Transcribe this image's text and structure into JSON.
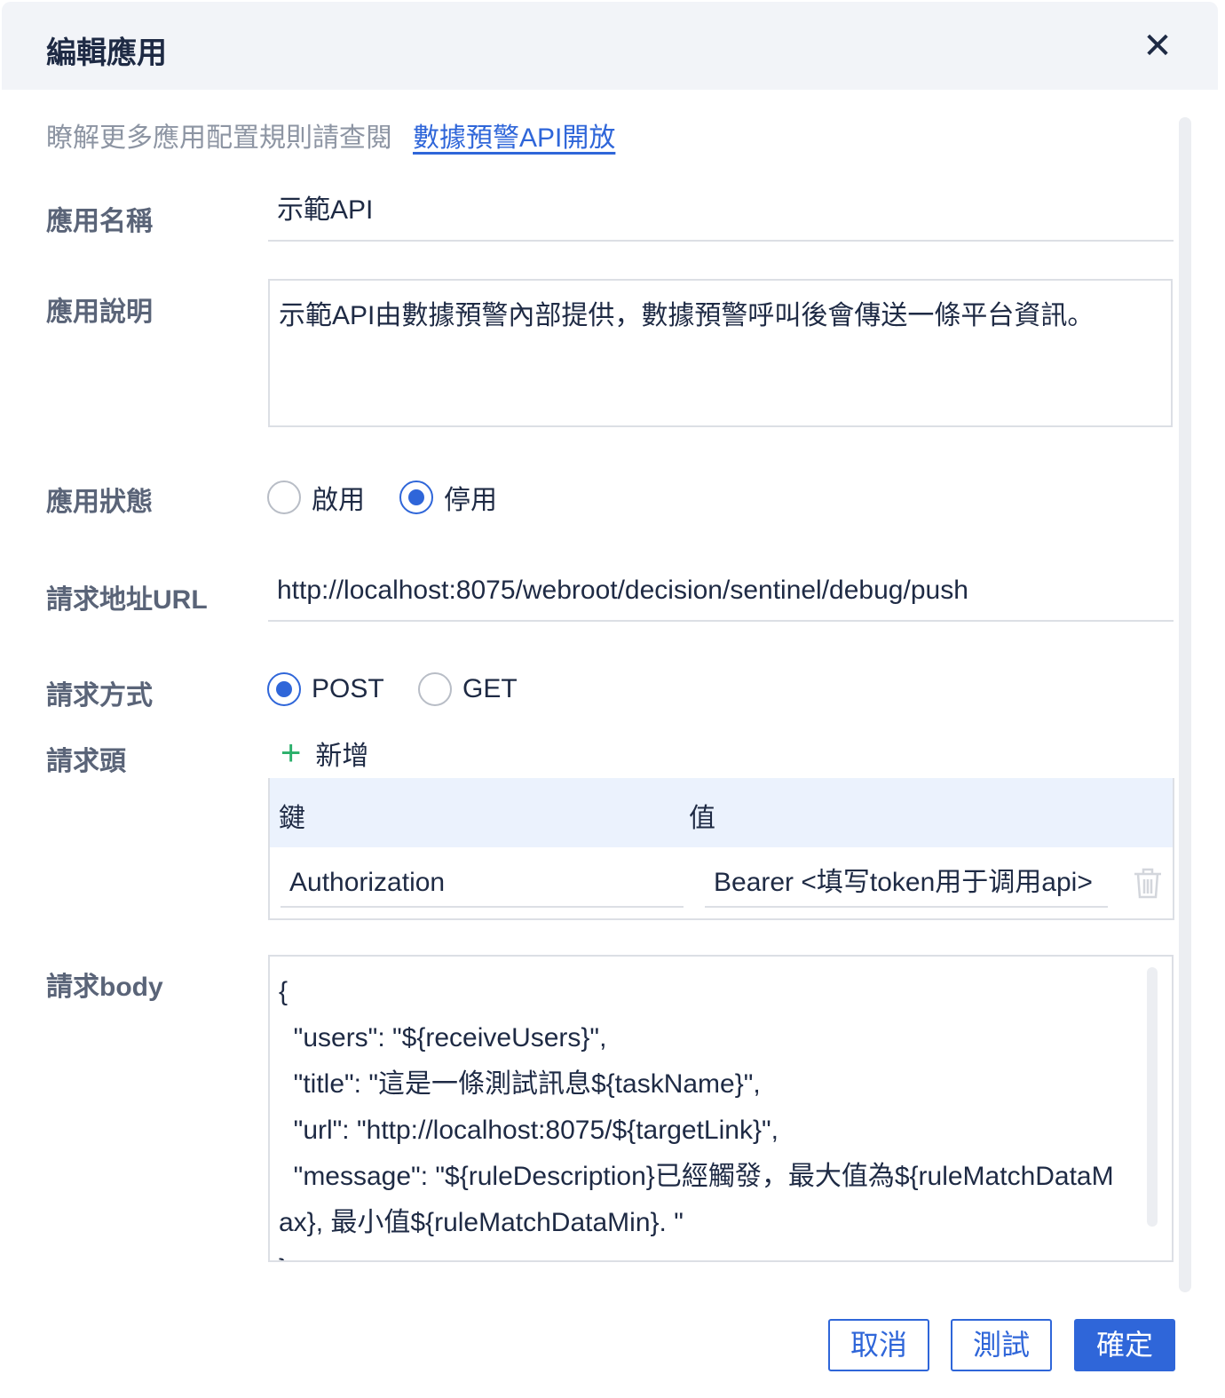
{
  "dialog": {
    "title": "編輯應用",
    "close_icon": "close-icon"
  },
  "hint": {
    "text": "瞭解更多應用配置規則請查閱",
    "link": "數據預警API開放"
  },
  "fields": {
    "name": {
      "label": "應用名稱",
      "value": "示範API"
    },
    "description": {
      "label": "應用說明",
      "value": "示範API由數據預警內部提供，數據預警呼叫後會傳送一條平台資訊。"
    },
    "status": {
      "label": "應用狀態",
      "options": [
        "啟用",
        "停用"
      ],
      "selected": "停用"
    },
    "url": {
      "label": "請求地址URL",
      "value": "http://localhost:8075/webroot/decision/sentinel/debug/push"
    },
    "method": {
      "label": "請求方式",
      "options": [
        "POST",
        "GET"
      ],
      "selected": "POST"
    },
    "headers": {
      "label": "請求頭",
      "add_label": "新增",
      "columns": [
        "鍵",
        "值"
      ],
      "rows": [
        {
          "key": "Authorization",
          "value": "Bearer <填写token用于调用api>"
        }
      ]
    },
    "body": {
      "label": "請求body",
      "value": "{\n  \"users\": \"${receiveUsers}\",\n  \"title\": \"這是一條測試訊息${taskName}\",\n  \"url\": \"http://localhost:8075/${targetLink}\",\n  \"message\": \"${ruleDescription}已經觸發，最大值為${ruleMatchDataMax}, 最小值${ruleMatchDataMin}. \"\n}"
    }
  },
  "footer": {
    "cancel": "取消",
    "test": "測試",
    "confirm": "確定"
  },
  "colors": {
    "accent": "#2f66d9",
    "add": "#2aaf6a",
    "header_bg": "#f2f4f8",
    "table_head": "#ebf2fd"
  }
}
